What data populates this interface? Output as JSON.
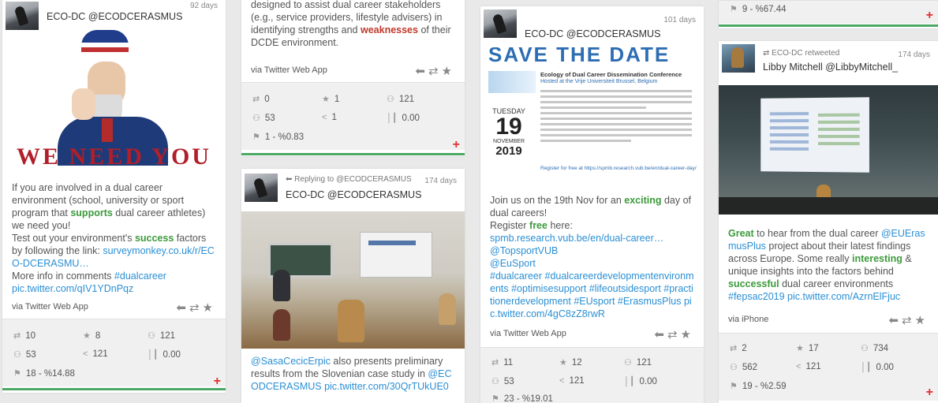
{
  "cards": {
    "c1": {
      "account": "ECO-DC @ECODCERASMUS",
      "days": "92 days",
      "image_caption": "WE NEED YOU",
      "text": {
        "p1": "If you are involved in a dual career environment (school, university or sport program that ",
        "h1": "supports",
        "p2": " dual career athletes) we need you!",
        "p3": "Test out your environment's ",
        "h2": "success",
        "p4": " factors by following the link: ",
        "l1": "surveymonkey.co.uk/r/ECO-DCERASMU…",
        "p5": "More info in comments ",
        "l2": "#dualcareer pic.twitter.com/qIV1YDnPqz"
      },
      "via": "via Twitter Web App",
      "stats": {
        "retweets": "10",
        "likes": "8",
        "reach": "121",
        "impressions": "53",
        "shares": "121",
        "score": "0.00",
        "rank": "18 - %14.88"
      }
    },
    "c2": {
      "text": {
        "p1": "designed to assist dual career stakeholders (e.g., service providers, lifestyle advisers) in identifying strengths and ",
        "h1": "weaknesses",
        "p2": " of their DCDE environment."
      },
      "via": "via Twitter Web App",
      "stats": {
        "retweets": "0",
        "likes": "1",
        "reach": "121",
        "impressions": "53",
        "shares": "1",
        "score": "0.00",
        "rank": "1 - %0.83"
      }
    },
    "c3": {
      "reply": "Replying to @ECODCERASMUS",
      "account": "ECO-DC @ECODCERASMUS",
      "days": "174 days",
      "text": {
        "l1": "@SasaCecicErpic",
        "p1": " also presents preliminary results from the Slovenian case study in ",
        "l2": "@ECODCERASMUS pic.twitter.com/30QrTUkUE0"
      }
    },
    "c4": {
      "account": "ECO-DC @ECODCERASMUS",
      "days": "101 days",
      "poster": {
        "headline": "SAVE THE DATE",
        "title": "Ecology of Dual Career Dissemination Conference",
        "subtitle": "Hosted at the Vrije Universiteit Brussel, Belgium",
        "weekday": "TUESDAY",
        "day": "19",
        "month": "NOVEMBER",
        "year": "2019",
        "register": "Register for free at https://spmb.research.vub.be/en/dual-career-day/"
      },
      "text": {
        "p1": "Join us on the 19th Nov for an ",
        "h1": "exciting",
        "p2": " day of dual careers!",
        "p3": "Register ",
        "h2": "free",
        "p4": " here: ",
        "l1": "spmb.research.vub.be/en/dual-career…",
        "l2": "@TopsportVUB",
        "l3": "@EuSport",
        "l4": "#dualcareer #dualcareerdevelopmentenvironments #optimisesupport #lifeoutsidesport #practitionerdevelopment #EUsport #ErasmusPlus pic.twitter.com/4gC8zZ8rwR"
      },
      "via": "via Twitter Web App",
      "stats": {
        "retweets": "11",
        "likes": "12",
        "reach": "121",
        "impressions": "53",
        "shares": "121",
        "score": "0.00",
        "rank": "23 - %19.01"
      }
    },
    "c5": {
      "rank": "9 - %67.44"
    },
    "c6": {
      "retweeted": "ECO-DC retweeted",
      "account": "Libby Mitchell @LibbyMitchell_",
      "days": "174 days",
      "text": {
        "h1": "Great",
        "p1": " to hear from the dual career ",
        "l1": "@EUErasmusPlus",
        "p2": " project about their latest findings across Europe. Some really ",
        "h2": "interesting",
        "p3": " & unique insights into the factors behind ",
        "h3": "successful",
        "p4": " dual career environments ",
        "l2": "#fepsac2019 pic.twitter.com/AzrnElFjuc"
      },
      "via": "via iPhone",
      "stats": {
        "retweets": "2",
        "likes": "17",
        "reach": "734",
        "impressions": "562",
        "shares": "121",
        "score": "0.00",
        "rank": "19 - %2.59"
      }
    }
  },
  "icons": {
    "retweet": "retweet-icon",
    "star": "star-icon",
    "reach": "people-icon",
    "share": "share-icon",
    "score": "bar-chart-icon",
    "rank": "rank-icon",
    "reply": "reply-icon",
    "plus": "plus-icon"
  },
  "colors": {
    "accent_green": "#4ca864",
    "link_blue": "#2a8fd4",
    "highlight_green": "#3c9a3c",
    "highlight_red": "#c0392b",
    "plus_red": "#e23030"
  }
}
